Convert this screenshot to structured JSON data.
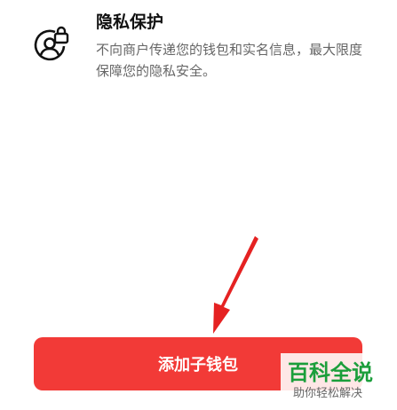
{
  "privacy": {
    "icon": "user-lock-icon",
    "title": "隐私保护",
    "description": "不向商户传递您的钱包和实名信息，最大限度保障您的隐私安全。"
  },
  "annotation": {
    "arrow": "red-arrow-icon",
    "color": "#e52222"
  },
  "action": {
    "add_label": "添加子钱包",
    "color": "#f23a37"
  },
  "watermark": {
    "title": "百科全说",
    "subtitle": "助你轻松解决",
    "color": "#1b9e3b"
  }
}
